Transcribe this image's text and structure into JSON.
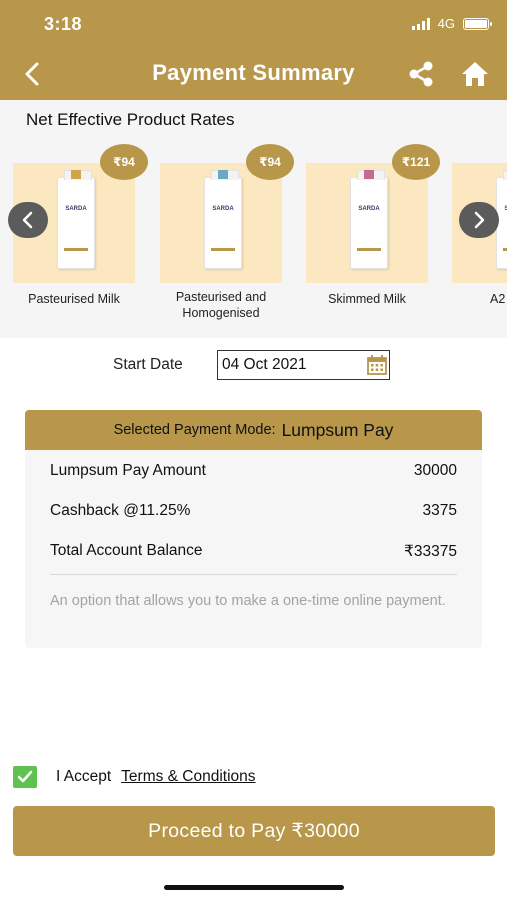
{
  "status_bar": {
    "time": "3:18",
    "network": "4G"
  },
  "header": {
    "title": "Payment Summary"
  },
  "products_section": {
    "title": "Net Effective Product Rates",
    "brand": "SARDA",
    "items": [
      {
        "label": "Pasteurised Milk",
        "price": "₹94",
        "cap_color": "#d4a449"
      },
      {
        "label": "Pasteurised and Homogenised",
        "price": "₹94",
        "cap_color": "#6aa9c4"
      },
      {
        "label": "Skimmed Milk",
        "price": "₹121",
        "cap_color": "#c46a93"
      },
      {
        "label": "A2",
        "price": "",
        "cap_color": "#d4a449"
      }
    ]
  },
  "start_date": {
    "label": "Start Date",
    "value": "04 Oct 2021"
  },
  "payment": {
    "mode_label": "Selected Payment Mode:",
    "mode_value": "Lumpsum Pay",
    "rows": [
      {
        "label": "Lumpsum Pay Amount",
        "value": "30000"
      },
      {
        "label": "Cashback @11.25%",
        "value": "3375"
      },
      {
        "label": "Total Account Balance",
        "value": "₹33375"
      }
    ],
    "description": "An option that allows you to make a one-time online payment."
  },
  "accept": {
    "text": "I Accept",
    "terms": "Terms & Conditions",
    "checked": true
  },
  "proceed_button": {
    "label": "Proceed to Pay ₹30000"
  },
  "colors": {
    "accent": "#b8974a",
    "product_bg": "#fbe8c0",
    "check_green": "#5fc24f"
  }
}
